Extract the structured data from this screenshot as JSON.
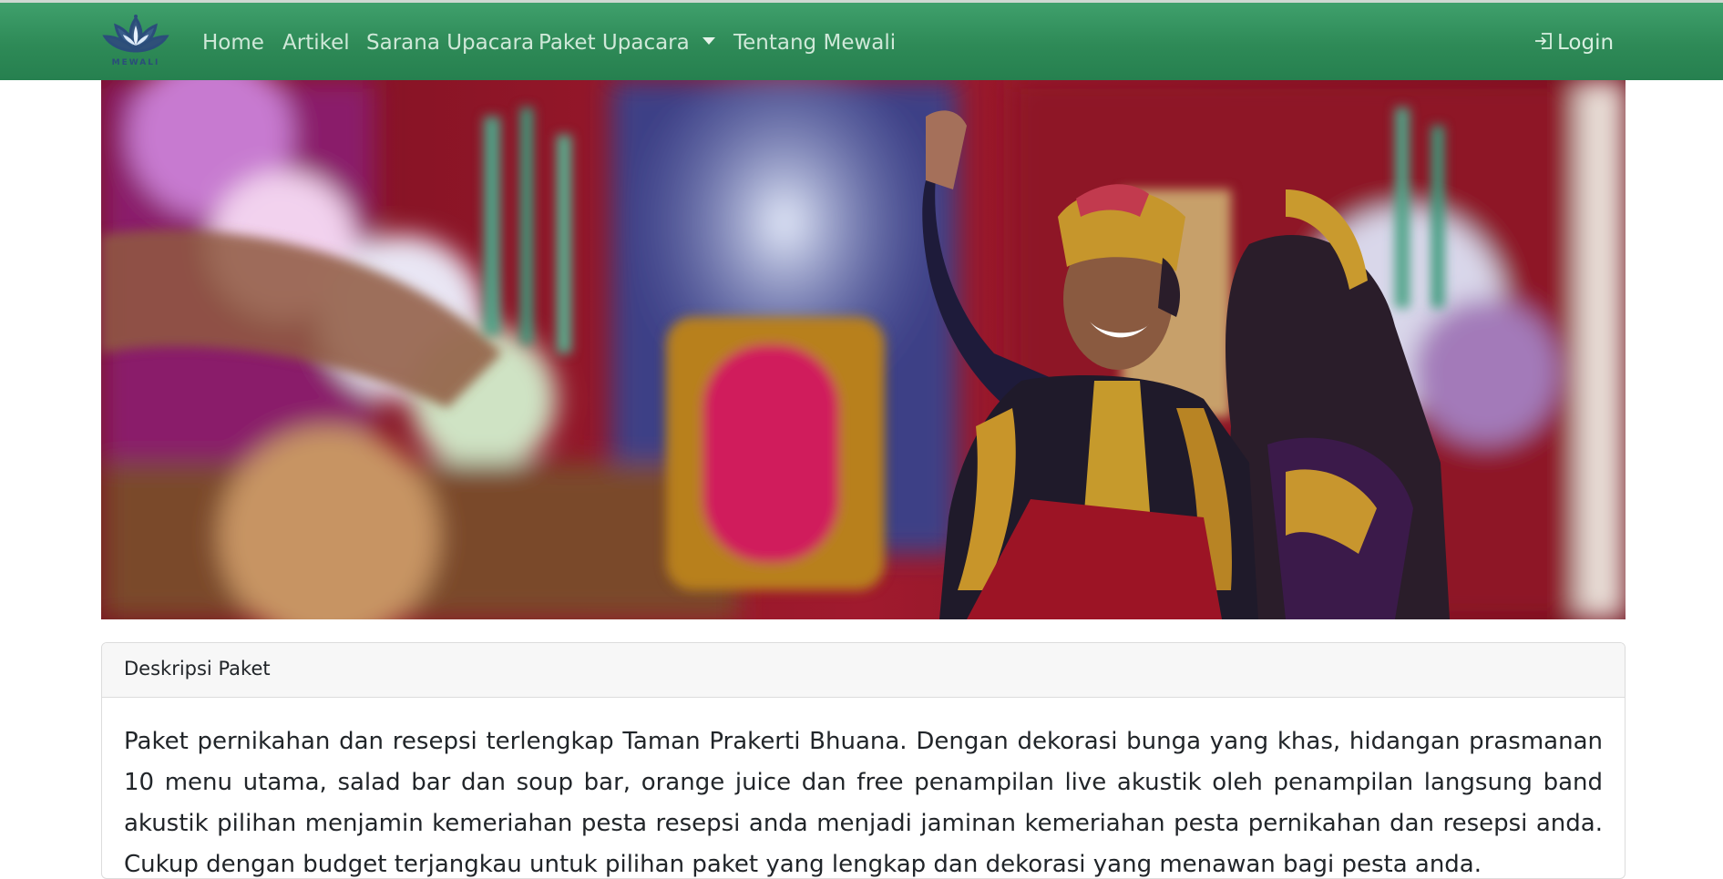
{
  "brand": {
    "logo_text": "MEWALI"
  },
  "nav": {
    "home": "Home",
    "artikel": "Artikel",
    "sarana": "Sarana Upacara",
    "paket": "Paket Upacara",
    "tentang": "Tentang Mewali",
    "login": "Login"
  },
  "card": {
    "header": "Deskripsi Paket",
    "body": "Paket pernikahan dan resepsi terlengkap Taman Prakerti Bhuana. Dengan dekorasi bunga yang khas, hidangan prasmanan 10 menu utama, salad bar dan soup bar, orange juice dan free penampilan live akustik oleh penampilan langsung band akustik pilihan menjamin kemeriahan pesta resepsi anda menjadi jaminan kemeriahan pesta pernikahan dan resepsi anda. Cukup dengan budget terjangkau untuk pilihan paket yang lengkap dan dekorasi yang menawan bagi pesta anda."
  },
  "colors": {
    "navbar": "#2e8a57",
    "nav_text": "#cfe8d8"
  }
}
